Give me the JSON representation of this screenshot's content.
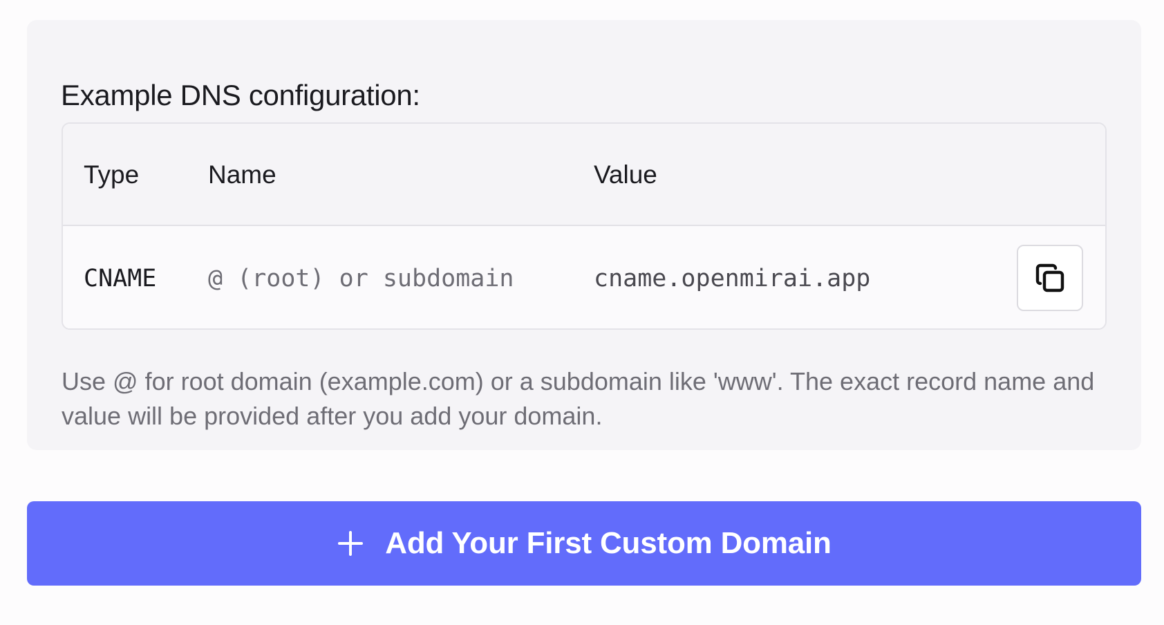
{
  "dns_example": {
    "heading": "Example DNS configuration:",
    "columns": {
      "type": "Type",
      "name": "Name",
      "value": "Value"
    },
    "record": {
      "type": "CNAME",
      "name": "@ (root) or subdomain",
      "value": "cname.openmirai.app"
    },
    "copy_icon": "copy-icon",
    "help_text": "Use @ for root domain (example.com) or a subdomain like 'www'. The exact record name and value will be provided after you add your domain."
  },
  "primary_action": {
    "icon": "plus-icon",
    "label": "Add Your First Custom Domain"
  },
  "colors": {
    "accent": "#626cfb",
    "card_background": "#f5f4f7",
    "muted_text": "#6e6d75"
  }
}
